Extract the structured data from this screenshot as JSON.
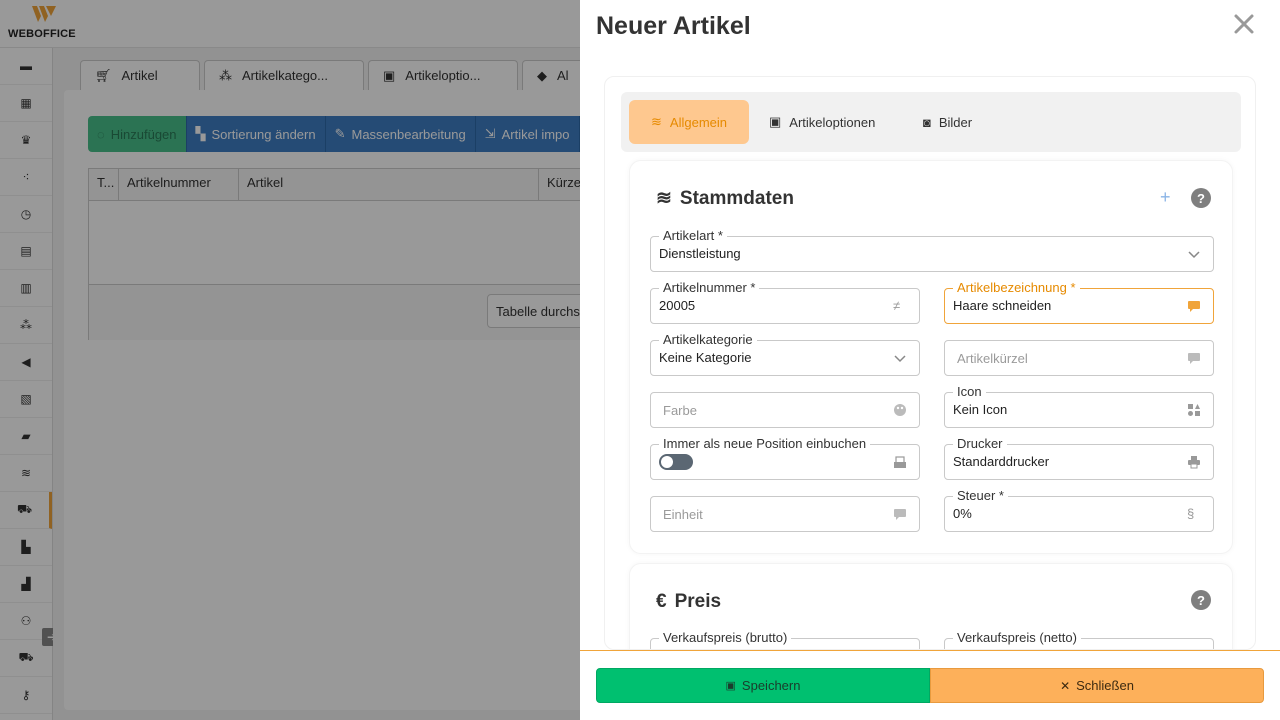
{
  "app": {
    "logo_text": "WEBOFFICE",
    "brand_color": "#f0a43a"
  },
  "sidebar": {
    "items": [
      {
        "icon": "register-icon"
      },
      {
        "icon": "calendar-icon"
      },
      {
        "icon": "crown-icon"
      },
      {
        "icon": "network-icon"
      },
      {
        "icon": "clock-icon"
      },
      {
        "icon": "document-icon"
      },
      {
        "icon": "receipt-icon"
      },
      {
        "icon": "cubes-icon"
      },
      {
        "icon": "megaphone-icon"
      },
      {
        "icon": "report-icon"
      },
      {
        "icon": "folder-icon"
      },
      {
        "icon": "database-icon"
      },
      {
        "icon": "cart-icon"
      },
      {
        "icon": "boxes-icon"
      },
      {
        "icon": "chart-icon"
      },
      {
        "icon": "users-icon"
      },
      {
        "icon": "truck-icon"
      },
      {
        "icon": "key-icon"
      }
    ],
    "expand_glyph": "➔"
  },
  "background": {
    "tabs": [
      {
        "label": "Artikel",
        "icon": "cart-icon"
      },
      {
        "label": "Artikelkatego...",
        "icon": "cubes-icon"
      },
      {
        "label": "Artikeloptio...",
        "icon": "image-icon"
      },
      {
        "label": "Al",
        "icon": "tag-icon"
      }
    ],
    "toolbar": [
      {
        "label": "Hinzufügen",
        "icon": "spinner-icon"
      },
      {
        "label": "Sortierung ändern",
        "icon": "sort-icon"
      },
      {
        "label": "Massenbearbeitung",
        "icon": "pencil-icon"
      },
      {
        "label": "Artikel impo",
        "icon": "import-icon"
      }
    ],
    "grid_columns": [
      "T...",
      "Artikelnummer",
      "Artikel",
      "Kürze"
    ],
    "table_button": "Tabelle durchsu"
  },
  "drawer": {
    "title": "Neuer Artikel",
    "tabs": [
      {
        "label": "Allgemein",
        "icon": "database-icon",
        "active": true
      },
      {
        "label": "Artikeloptionen",
        "icon": "image-icon",
        "active": false
      },
      {
        "label": "Bilder",
        "icon": "camera-icon",
        "active": false
      }
    ],
    "stammdaten": {
      "title": "Stammdaten",
      "help": "?",
      "plus": "+",
      "artikelart_label": "Artikelart *",
      "artikelart_value": "Dienstleistung",
      "artikelnummer_label": "Artikelnummer *",
      "artikelnummer_value": "20005",
      "artikelbezeichnung_label": "Artikelbezeichnung *",
      "artikelbezeichnung_value": "Haare schneiden",
      "artikelkategorie_label": "Artikelkategorie",
      "artikelkategorie_value": "Keine Kategorie",
      "artikelkuerzel_placeholder": "Artikelkürzel",
      "farbe_placeholder": "Farbe",
      "icon_label": "Icon",
      "icon_value": "Kein Icon",
      "immer_label": "Immer als neue Position einbuchen",
      "immer_value": false,
      "drucker_label": "Drucker",
      "drucker_value": "Standarddrucker",
      "einheit_placeholder": "Einheit",
      "steuer_label": "Steuer *",
      "steuer_value": "0%"
    },
    "preis": {
      "title": "Preis",
      "help": "?",
      "brutto_label": "Verkaufspreis (brutto)",
      "netto_label": "Verkaufspreis (netto)"
    },
    "save_label": "Speichern",
    "close_label": "Schließen",
    "colors": {
      "save": "#00c070",
      "close": "#fdb05a",
      "active_tab": "#fec88f"
    }
  }
}
